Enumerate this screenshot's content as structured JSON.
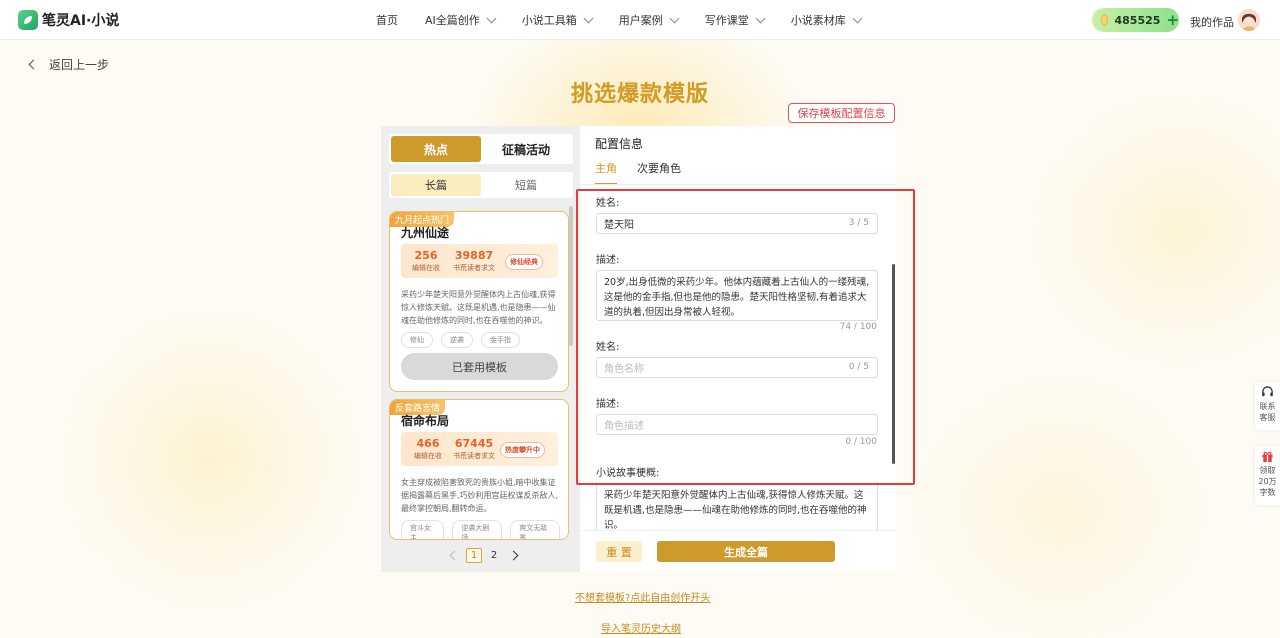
{
  "header": {
    "logo_text": "笔灵AI·小说",
    "nav": [
      "首页",
      "AI全篇创作",
      "小说工具箱",
      "用户案例",
      "写作课堂",
      "小说素材库"
    ],
    "points": "485525",
    "my_works": "我的作品"
  },
  "back_label": "返回上一步",
  "page_title": "挑选爆款模版",
  "save_config_label": "保存模板配置信息",
  "left": {
    "tabs": [
      "热点",
      "征稿活动"
    ],
    "subtabs": [
      "长篇",
      "短篇"
    ],
    "cards": [
      {
        "tag": "九月起点热门",
        "title": "九州仙途",
        "stat1_num": "256",
        "stat1_label": "编辑在收",
        "stat2_num": "39887",
        "stat2_label": "书荒读者求文",
        "badge": "修仙经典",
        "desc": "采药少年楚天阳意外觉醒体内上古仙魂,获得惊人修炼天赋。这既是机遇,也是隐患——仙魂在助他修炼的同时,也在吞噬他的神识。",
        "chips": [
          "修仙",
          "逆袭",
          "金手指"
        ],
        "button": "已套用模板"
      },
      {
        "tag": "反套路言情",
        "title": "宿命布局",
        "stat1_num": "466",
        "stat1_label": "编辑在收",
        "stat2_num": "67445",
        "stat2_label": "书荒读者求文",
        "badge": "热度攀升中",
        "desc": "女主穿成被陷害致死的贵族小姐,暗中收集证据揭露幕后黑手,巧妙利用宫廷权谋反杀敌人,最终掌控朝局,翻转命运。",
        "chips": [
          "宫斗女主",
          "逆袭大剧场",
          "爽文无敌秀"
        ]
      }
    ],
    "pager": [
      "1",
      "2"
    ]
  },
  "config": {
    "title": "配置信息",
    "role_tabs": [
      "主角",
      "次要角色"
    ],
    "name_label": "姓名:",
    "name_value": "楚天阳",
    "name_count": "3 / 5",
    "desc_label": "描述:",
    "desc_value": "20岁,出身低微的采药少年。他体内蕴藏着上古仙人的一缕残魂,这是他的金手指,但也是他的隐患。楚天阳性格坚韧,有着追求大道的执着,但因出身常被人轻视。",
    "desc_count": "74 / 100",
    "name2_label": "姓名:",
    "name2_placeholder": "角色名称",
    "name2_count": "0 / 5",
    "desc2_label": "描述:",
    "desc2_placeholder": "角色描述",
    "desc2_count": "0 / 100",
    "synopsis_label": "小说故事梗概:",
    "synopsis_value": "采药少年楚天阳意外觉醒体内上古仙魂,获得惊人修炼天赋。这既是机遇,也是隐患——仙魂在助他修炼的同时,也在吞噬他的神识。",
    "reset_label": "重 置",
    "generate_label": "生成全篇"
  },
  "links": {
    "free_create": "不想套模板?点此自由创作开头",
    "import_outline": "导入笔灵历史大纲"
  },
  "float": {
    "service": "联系客服",
    "gift": "领取20万字数"
  },
  "colors": {
    "accent": "#cf9a2c",
    "highlight_border": "#e23c3c"
  }
}
